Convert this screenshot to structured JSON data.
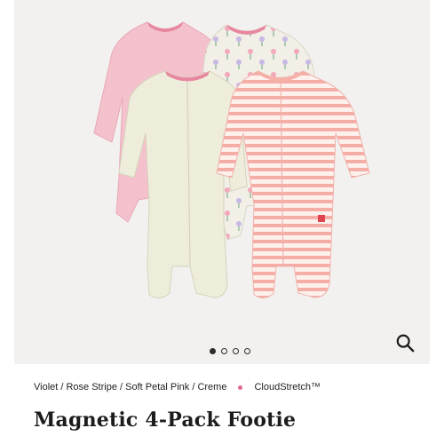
{
  "gallery": {
    "image_alt": "Magnetic 4-Pack Footie",
    "slide_count": 4,
    "active_slide": 1
  },
  "zoom": {
    "icon": "search-icon"
  },
  "product": {
    "colorways": "Violet / Rose Stripe / Soft Petal Pink / Creme",
    "fabric": "CloudStretch™",
    "title": "Magnetic 4-Pack Footie"
  },
  "colors": {
    "pink_solid": "#f3bfcb",
    "creme": "#eeedd9",
    "floral_bg": "#f1efe6",
    "stripe_pink": "#f4a8a0",
    "accent_dot": "#e06b8a"
  }
}
